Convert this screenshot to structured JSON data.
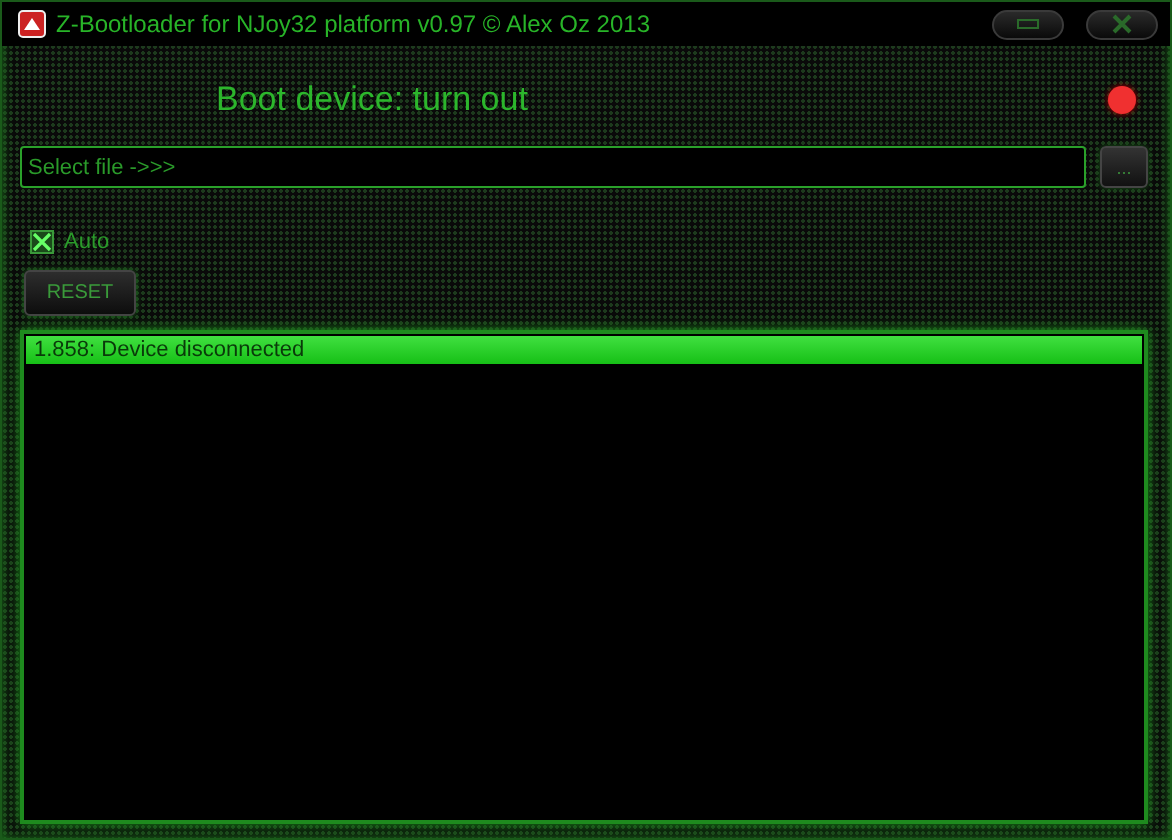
{
  "window": {
    "title": "Z-Bootloader for NJoy32 platform v0.97 © Alex Oz 2013"
  },
  "status": {
    "label": "Boot device: turn out",
    "connected": false
  },
  "file_field": {
    "value": "Select file ->>>"
  },
  "browse_button": {
    "label": "..."
  },
  "auto_checkbox": {
    "label": "Auto",
    "checked": true
  },
  "reset_button": {
    "label": "RESET"
  },
  "log": [
    {
      "text": "1.858: Device disconnected",
      "selected": true
    }
  ]
}
